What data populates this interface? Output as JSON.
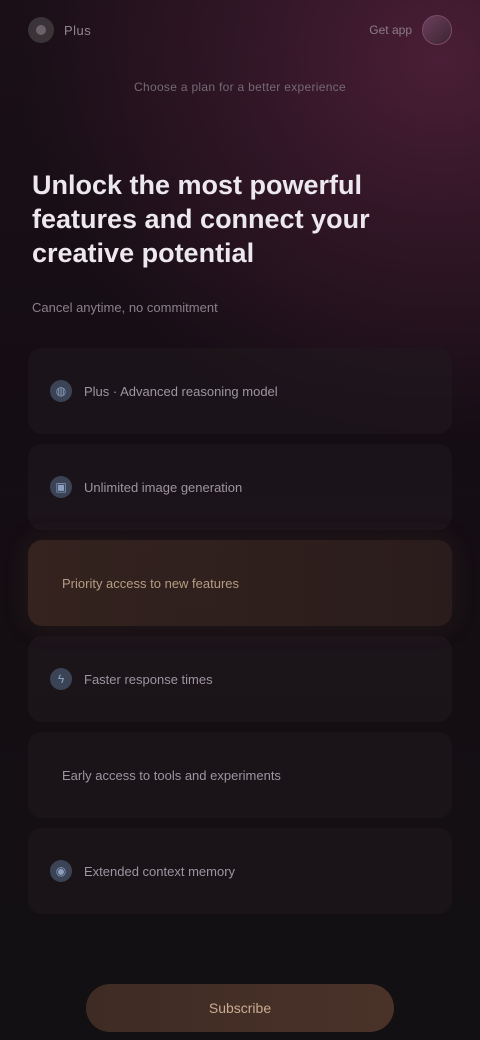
{
  "header": {
    "brand": "Plus",
    "link_label": "Get app"
  },
  "subnav": "Choose a plan for a better experience",
  "headline": "Unlock the most powerful features and connect your creative potential",
  "subhead": "Cancel anytime, no commitment",
  "options": [
    {
      "label": "Plus · Advanced reasoning model",
      "icon": "globe-icon",
      "style": "normal"
    },
    {
      "label": "Unlimited image generation",
      "icon": "image-icon",
      "style": "normal"
    },
    {
      "label": "Priority access to new features",
      "icon": "",
      "style": "highlight"
    },
    {
      "label": "Faster response times",
      "icon": "bolt-icon",
      "style": "normal"
    },
    {
      "label": "Early access to tools and experiments",
      "icon": "",
      "style": "textonly"
    },
    {
      "label": "Extended context memory",
      "icon": "brain-icon",
      "style": "normal"
    }
  ],
  "cta_label": "Subscribe",
  "colors": {
    "accent_warm": "#b69c84",
    "background": "#150d14",
    "glow": "#4a1e36"
  }
}
